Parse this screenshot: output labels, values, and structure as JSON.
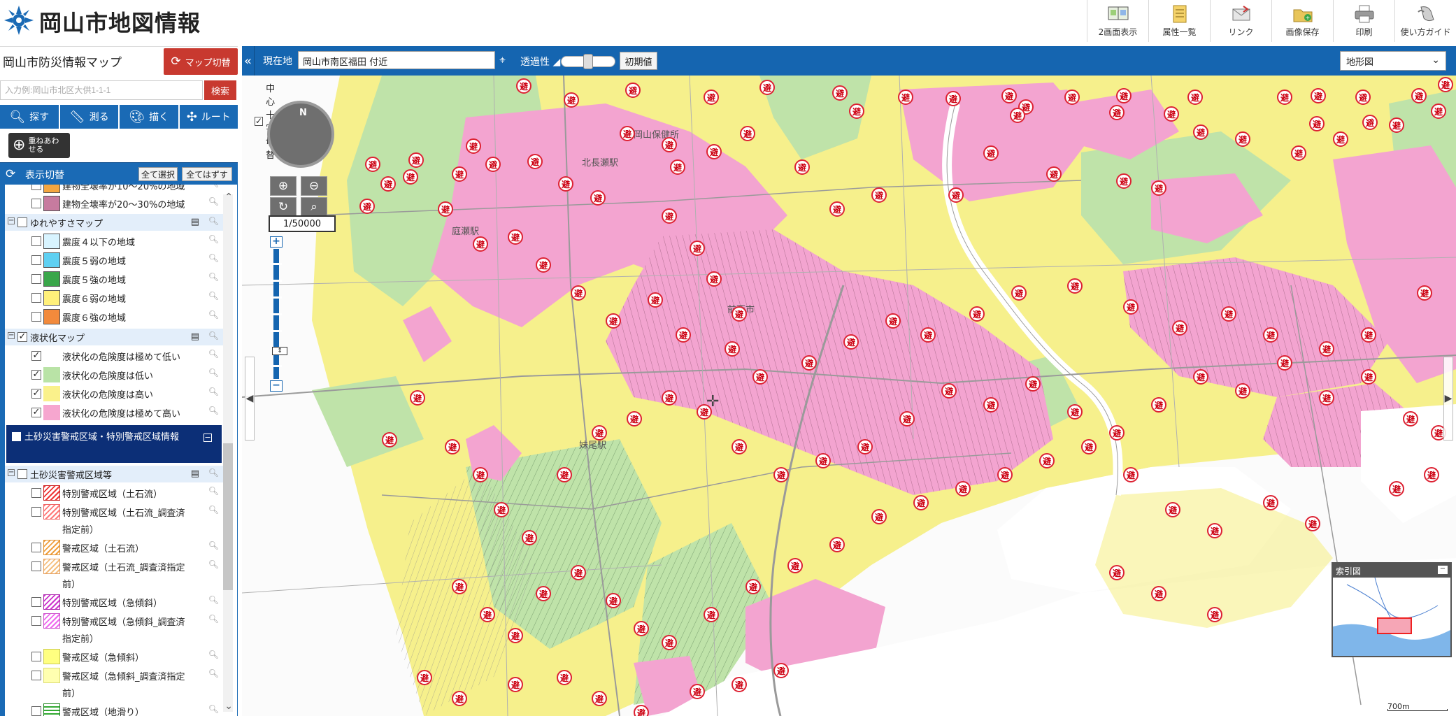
{
  "header": {
    "app_title": "岡山市地図情報",
    "toolbar": [
      {
        "label": "2画面表示",
        "icon": "dual-screen-icon"
      },
      {
        "label": "属性一覧",
        "icon": "attribute-list-icon"
      },
      {
        "label": "リンク",
        "icon": "link-icon"
      },
      {
        "label": "画像保存",
        "icon": "save-image-icon"
      },
      {
        "label": "印刷",
        "icon": "print-icon"
      },
      {
        "label": "使い方ガイド",
        "icon": "guide-icon"
      }
    ]
  },
  "left_panel": {
    "portal_title": "岡山市防災情報マップ",
    "map_switch_label": "マップ切替",
    "search": {
      "placeholder": "入力例:岡山市北区大供1-1-1",
      "button_label": "検索"
    },
    "functions": [
      {
        "label": "探す",
        "icon": "search-icon"
      },
      {
        "label": "測る",
        "icon": "ruler-icon"
      },
      {
        "label": "描く",
        "icon": "palette-icon"
      },
      {
        "label": "ルート",
        "icon": "route-icon"
      }
    ],
    "overlay_label": "重ねあわせる",
    "layer_header": {
      "title": "表示切替",
      "select_all": "全て選択",
      "deselect_all": "全てはずす"
    },
    "layers": {
      "partial_top": "建物全壊率が10～20%の地域",
      "row1": "建物全壊率が20～30%の地域",
      "group_shaking": "ゆれやすさマップ",
      "shaking_items": [
        "震度４以下の地域",
        "震度５弱の地域",
        "震度５強の地域",
        "震度６弱の地域",
        "震度６強の地域"
      ],
      "group_liquefaction": "液状化マップ",
      "liquefaction_items": [
        "液状化の危険度は極めて低い",
        "液状化の危険度は低い",
        "液状化の危険度は高い",
        "液状化の危険度は極めて高い"
      ],
      "dark_section": "土砂災害警戒区域・特別警戒区域情報",
      "group_sediment": "土砂災害警戒区域等",
      "sediment_items": [
        "特別警戒区域（土石流）",
        "特別警戒区域（土石流_調査済",
        "指定前）",
        "警戒区域（土石流）",
        "警戒区域（土石流_調査済指定",
        "前）",
        "特別警戒区域（急傾斜）",
        "特別警戒区域（急傾斜_調査済",
        "指定前）",
        "警戒区域（急傾斜）",
        "警戒区域（急傾斜_調査済指定",
        "前）",
        "警戒区域（地滑り）"
      ]
    },
    "swatch_colors": {
      "orange": "#f4a640",
      "mauve": "#c77b9f",
      "lightcyan": "#d8f4ff",
      "cyan": "#5fd0f2",
      "green": "#3aa64a",
      "yellow": "#fff07a",
      "orangered": "#f28a3c",
      "liq_green": "#b9e3a6",
      "liq_yellow": "#faf18b",
      "liq_pink": "#f6a6cf"
    }
  },
  "map_bar": {
    "location_label": "現在地",
    "location_value": "岡山市南区福田 付近",
    "transparency_label": "透過性",
    "reset_label": "初期値",
    "basemap": "地形図"
  },
  "map": {
    "center_cross_label": "中心十字切替",
    "scale": "1/50000",
    "compass_north": "N",
    "index_map_title": "索引図",
    "scalebar_label": "700m",
    "place_labels": [
      "岡山保健所",
      "北長瀬駅",
      "庭瀬駅",
      "前西市",
      "妹尾駅"
    ],
    "shelter_symbol": "避",
    "colors": {
      "pink": "#f3a4d0",
      "yellow": "#f6f08c",
      "green": "#bfe3a9",
      "water": "#ffffff",
      "road": "#9a9a9a"
    }
  }
}
